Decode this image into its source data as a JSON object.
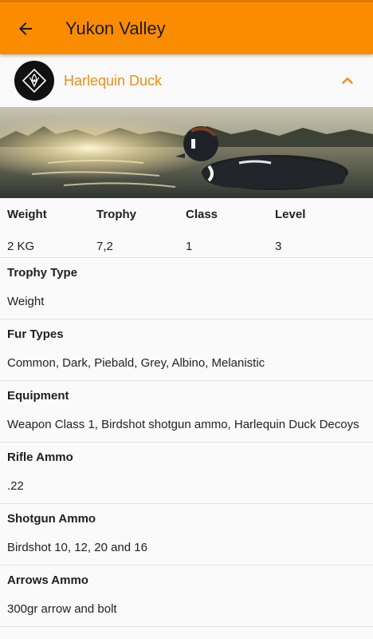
{
  "appbar": {
    "title": "Yukon Valley"
  },
  "animal": {
    "name": "Harlequin Duck"
  },
  "stats": {
    "headers": [
      "Weight",
      "Trophy",
      "Class",
      "Level"
    ],
    "values": [
      "2 KG",
      "7,2",
      "1",
      "3"
    ]
  },
  "sections": [
    {
      "title": "Trophy Type",
      "body": "Weight"
    },
    {
      "title": "Fur Types",
      "body": "Common, Dark, Piebald, Grey, Albino, Melanistic"
    },
    {
      "title": "Equipment",
      "body": "Weapon Class 1, Birdshot shotgun ammo, Harlequin Duck Decoys"
    },
    {
      "title": "Rifle Ammo",
      "body": ".22"
    },
    {
      "title": "Shotgun Ammo",
      "body": "Birdshot 10, 12, 20 and 16"
    },
    {
      "title": "Arrows Ammo",
      "body": "300gr arrow and bolt"
    }
  ],
  "colors": {
    "accent": "#fb8c00",
    "accent_text": "#f28c13"
  },
  "icons": {
    "back": "arrow-left-icon",
    "collapse": "chevron-up-icon",
    "logo": "hunting-emblem-icon"
  }
}
